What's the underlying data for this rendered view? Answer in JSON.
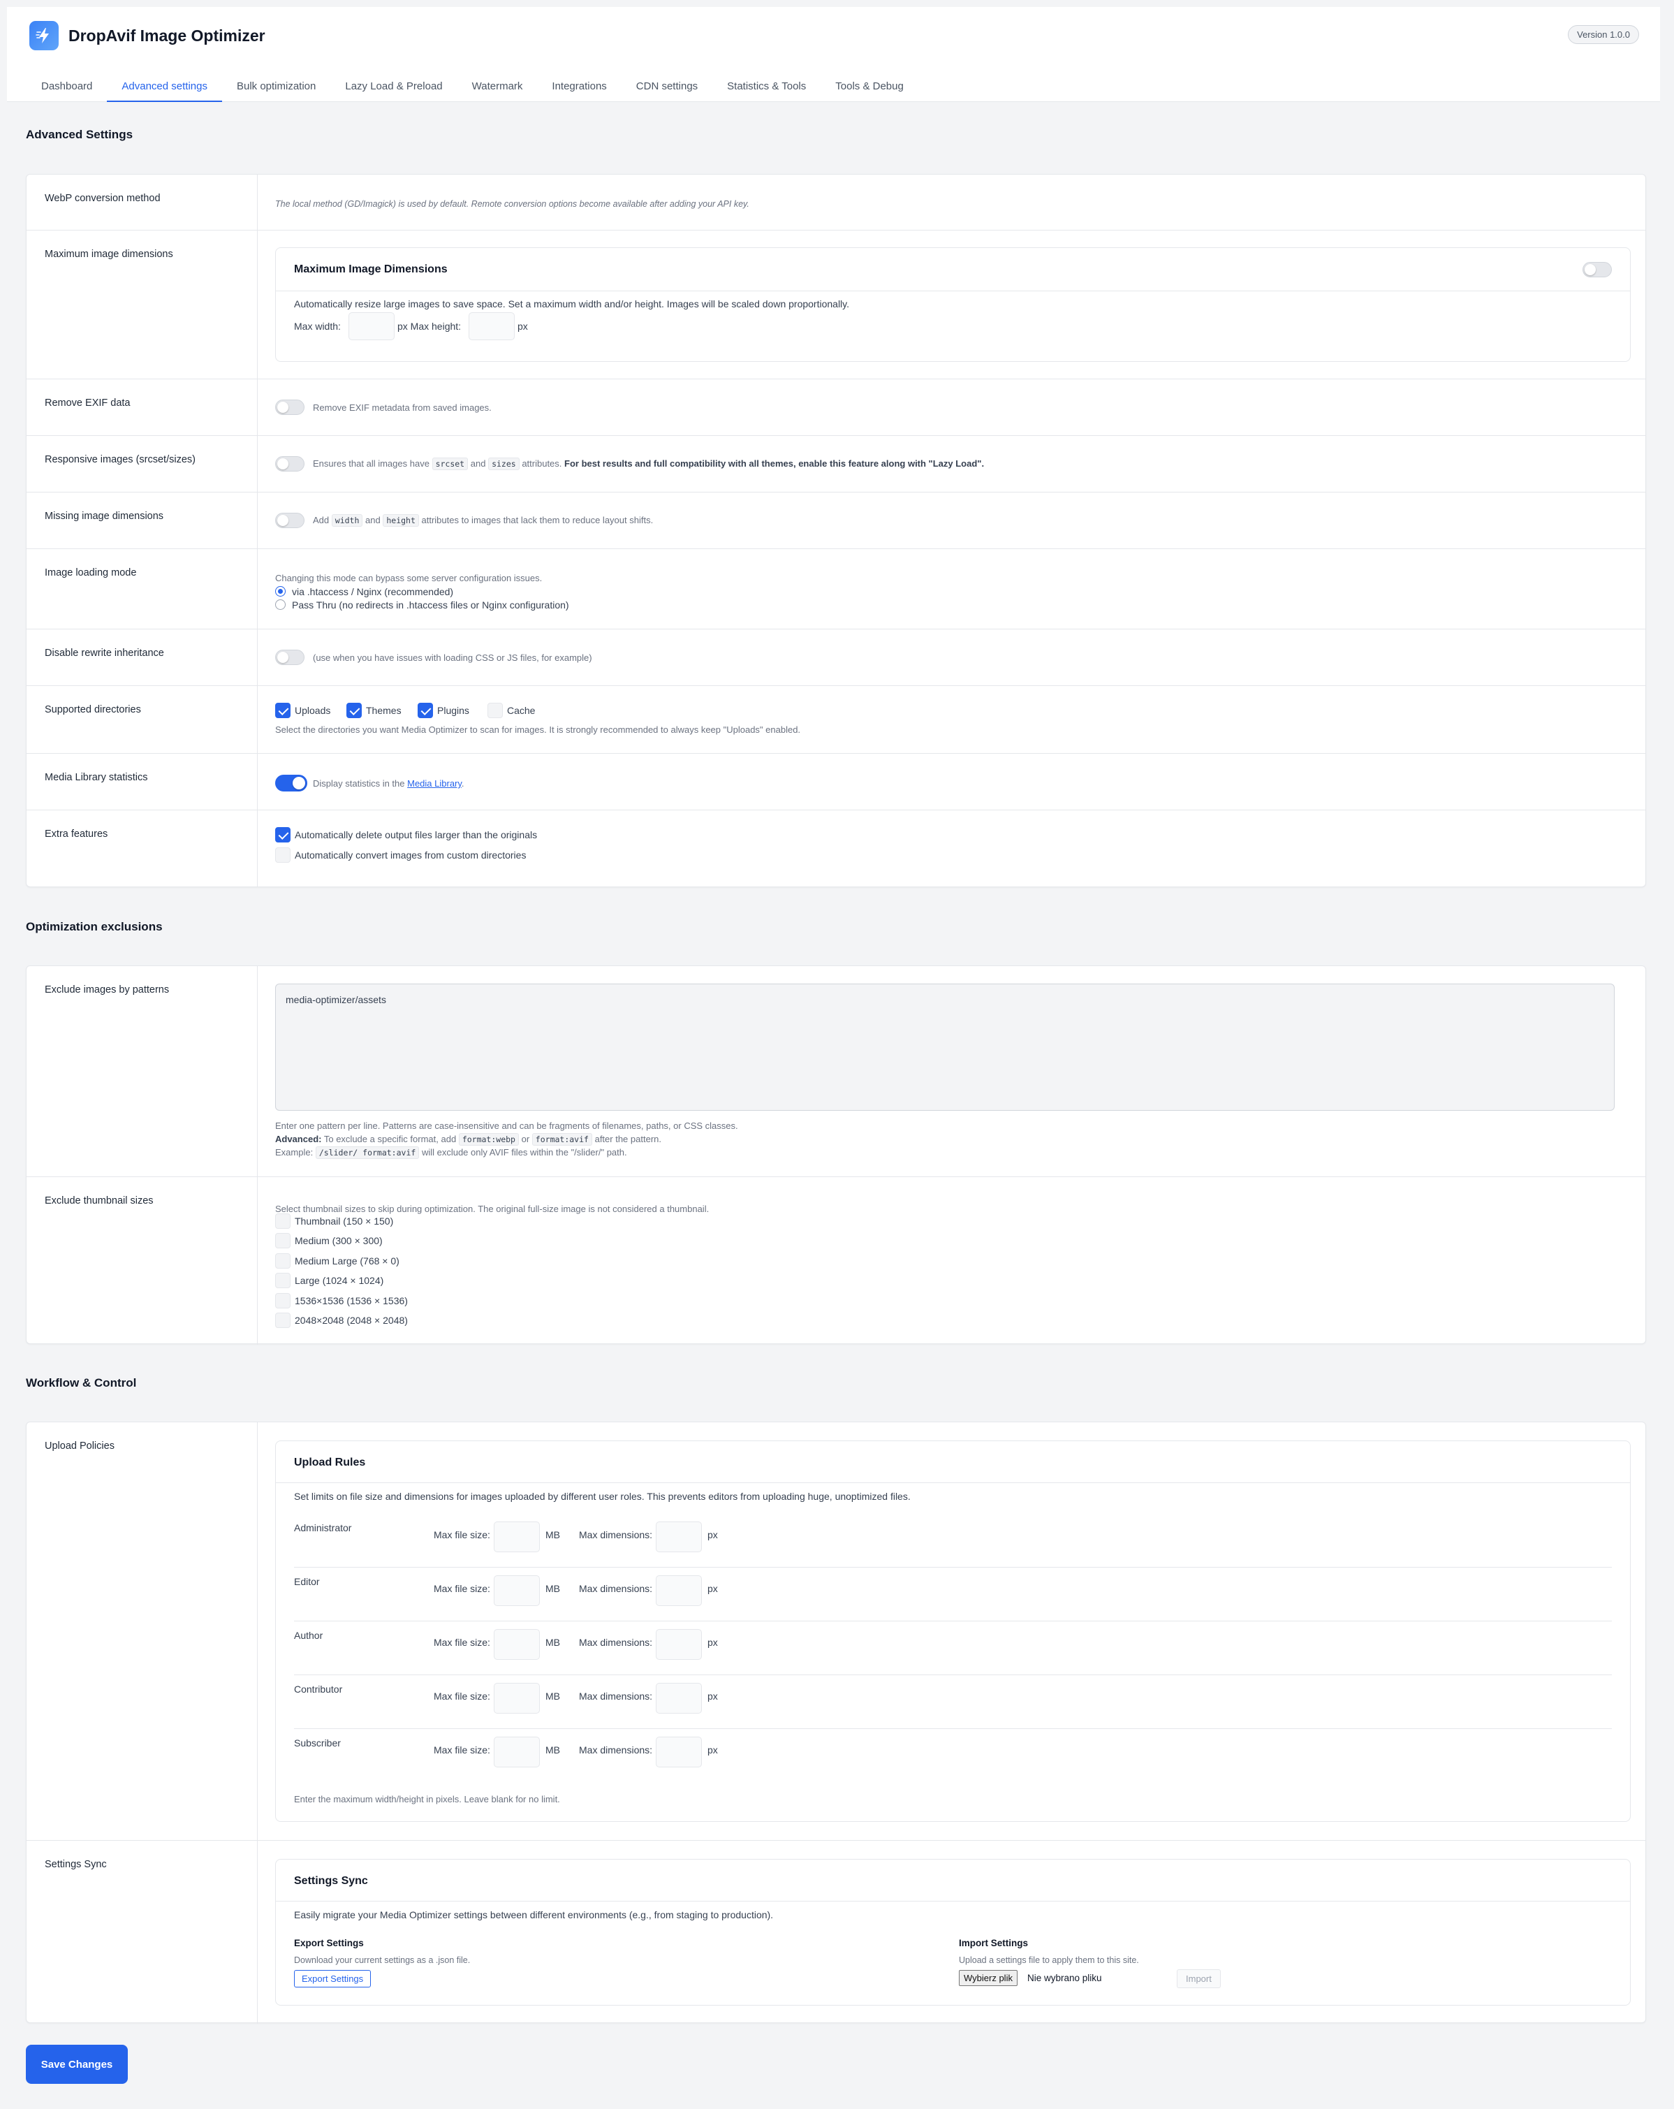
{
  "app": {
    "title": "DropAvif Image Optimizer",
    "version": "Version 1.0.0"
  },
  "tabs": [
    "Dashboard",
    "Advanced settings",
    "Bulk optimization",
    "Lazy Load & Preload",
    "Watermark",
    "Integrations",
    "CDN settings",
    "Statistics & Tools",
    "Tools & Debug"
  ],
  "active_tab": "Advanced settings",
  "advanced": {
    "title": "Advanced Settings",
    "webp": {
      "label": "WebP conversion method",
      "note": "The local method (GD/Imagick) is used by default. Remote conversion options become available after adding your API key."
    },
    "maxdim": {
      "label": "Maximum image dimensions",
      "card_title": "Maximum Image Dimensions",
      "enabled": false,
      "desc": "Automatically resize large images to save space. Set a maximum width and/or height. Images will be scaled down proportionally.",
      "max_width_label": "Max width:",
      "px_max_height_label": "px Max height:",
      "px_label": "px"
    },
    "exif": {
      "label": "Remove EXIF data",
      "enabled": false,
      "desc": "Remove EXIF metadata from saved images."
    },
    "responsive": {
      "label": "Responsive images (srcset/sizes)",
      "enabled": false,
      "desc_1": "Ensures that all images have",
      "code_1": "srcset",
      "and": "and",
      "code_2": "sizes",
      "desc_2": "attributes.",
      "desc_bold": "For best results and full compatibility with all themes, enable this feature along with \"Lazy Load\"."
    },
    "missing": {
      "label": "Missing image dimensions",
      "enabled": false,
      "add": "Add",
      "code_1": "width",
      "and": "and",
      "code_2": "height",
      "desc": "attributes to images that lack them to reduce layout shifts."
    },
    "loading": {
      "label": "Image loading mode",
      "note": "Changing this mode can bypass some server configuration issues.",
      "option_1": "via .htaccess / Nginx (recommended)",
      "option_2": "Pass Thru (no redirects in .htaccess files or Nginx configuration)",
      "selected": "via .htaccess / Nginx (recommended)"
    },
    "rewrite": {
      "label": "Disable rewrite inheritance",
      "enabled": false,
      "desc": "(use when you have issues with loading CSS or JS files, for example)"
    },
    "dirs": {
      "label": "Supported directories",
      "uploads": "Uploads",
      "themes": "Themes",
      "plugins": "Plugins",
      "cache": "Cache",
      "note": "Select the directories you want Media Optimizer to scan for images. It is strongly recommended to always keep \"Uploads\" enabled."
    },
    "stats": {
      "label": "Media Library statistics",
      "enabled": true,
      "desc": "Display statistics in the",
      "link": "Media Library",
      "period": "."
    },
    "extra": {
      "label": "Extra features",
      "opt_1": "Automatically delete output files larger than the originals",
      "opt_2": "Automatically convert images from custom directories"
    }
  },
  "exclusions": {
    "title": "Optimization exclusions",
    "patterns": {
      "label": "Exclude images by patterns",
      "value": "media-optimizer/assets",
      "help_1": "Enter one pattern per line. Patterns are case-insensitive and can be fragments of filenames, paths, or CSS classes.",
      "advanced_bold": "Advanced:",
      "advanced_text": "To exclude a specific format, add",
      "code_webp": "format:webp",
      "or": "or",
      "code_avif": "format:avif",
      "after": "after the pattern.",
      "example_label": "Example:",
      "code_example": "/slider/ format:avif",
      "example_text": "will exclude only AVIF files within the \"/slider/\" path."
    },
    "thumbs": {
      "label": "Exclude thumbnail sizes",
      "note": "Select thumbnail sizes to skip during optimization. The original full-size image is not considered a thumbnail.",
      "sizes": [
        "Thumbnail (150 × 150)",
        "Medium (300 × 300)",
        "Medium Large (768 × 0)",
        "Large (1024 × 1024)",
        "1536×1536 (1536 × 1536)",
        "2048×2048 (2048 × 2048)"
      ]
    }
  },
  "workflow": {
    "title": "Workflow & Control",
    "upload": {
      "label": "Upload Policies",
      "card_title": "Upload Rules",
      "desc": "Set limits on file size and dimensions for images uploaded by different user roles. This prevents editors from uploading huge, unoptimized files.",
      "max_file_size": "Max file size:",
      "mb": "MB",
      "max_dimensions": "Max dimensions:",
      "px": "px",
      "roles": [
        "Administrator",
        "Editor",
        "Author",
        "Contributor",
        "Subscriber"
      ],
      "footer": "Enter the maximum width/height in pixels. Leave blank for no limit."
    },
    "sync": {
      "label": "Settings Sync",
      "card_title": "Settings Sync",
      "desc": "Easily migrate your Media Optimizer settings between different environments (e.g., from staging to production).",
      "export_title": "Export Settings",
      "export_desc": "Download your current settings as a .json file.",
      "export_button": "Export Settings",
      "import_title": "Import Settings",
      "import_desc": "Upload a settings file to apply them to this site.",
      "file_button": "Wybierz plik",
      "file_status": "Nie wybrano pliku",
      "import_button": "Import"
    }
  },
  "save_button": "Save Changes"
}
